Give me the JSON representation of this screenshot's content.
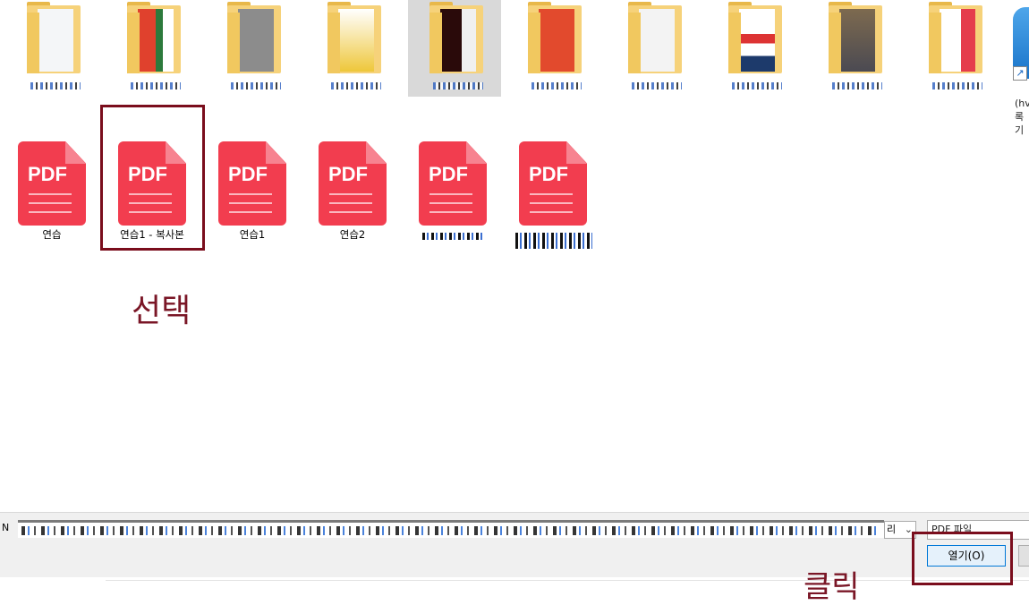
{
  "files": [
    {
      "name": "연습"
    },
    {
      "name": "연습1 - 복사본"
    },
    {
      "name": "연습1"
    },
    {
      "name": "연습2"
    },
    {
      "name": ""
    },
    {
      "name": ""
    }
  ],
  "folders_count_note": "",
  "shortcut": {
    "text": "(hv\n록\n기"
  },
  "annotations": {
    "select": "선택",
    "click": "클릭"
  },
  "dialog": {
    "filename_field_label": "N",
    "filename_dropdown_text": "리",
    "filetype": "PDF 파일",
    "open_button": "열기(O)"
  },
  "colors": {
    "pdf_red": "#f23d4f",
    "highlight": "#7a0d1c",
    "annotation": "#7a1626",
    "accent_blue": "#0078d7"
  }
}
